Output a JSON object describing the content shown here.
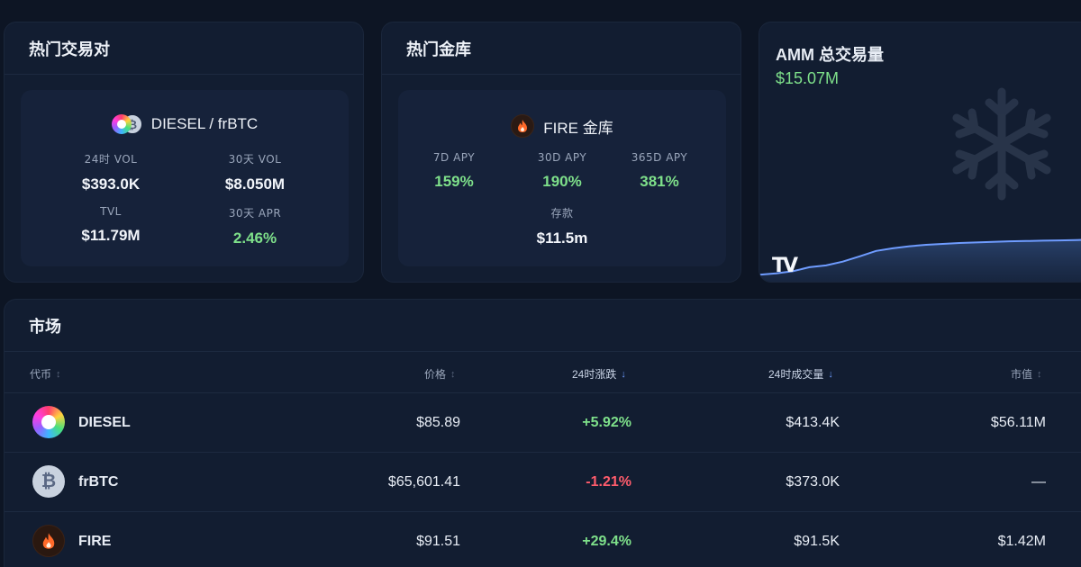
{
  "hot_pairs": {
    "title": "热门交易对",
    "pair_name": "DIESEL / frBTC",
    "stats": [
      {
        "label": "24时 VOL",
        "value": "$393.0K"
      },
      {
        "label": "30天 VOL",
        "value": "$8.050M"
      },
      {
        "label": "TVL",
        "value": "$11.79M"
      },
      {
        "label": "30天 APR",
        "value": "2.46%"
      }
    ]
  },
  "hot_vaults": {
    "title": "热门金库",
    "vault_name": "FIRE 金库",
    "stats": [
      {
        "label": "7D APY",
        "value": "159%"
      },
      {
        "label": "30D APY",
        "value": "190%"
      },
      {
        "label": "365D APY",
        "value": "381%"
      },
      {
        "label": "存款",
        "value": "$11.5m"
      }
    ]
  },
  "amm": {
    "title": "AMM 总交易量",
    "value": "$15.07M",
    "logo_text": "TV"
  },
  "chart_data": {
    "type": "area",
    "title": "AMM 总交易量",
    "x": [
      0,
      5,
      10,
      15,
      20,
      25,
      30,
      35,
      40,
      45,
      50,
      55,
      60,
      65,
      70,
      75,
      80,
      85,
      90,
      95,
      100
    ],
    "values": [
      3.0,
      3.5,
      4.2,
      5.6,
      6.2,
      7.5,
      9.3,
      11.2,
      12.1,
      12.8,
      13.3,
      13.6,
      13.9,
      14.1,
      14.3,
      14.5,
      14.6,
      14.7,
      14.8,
      14.9,
      15.07
    ],
    "ylim": [
      0,
      34
    ],
    "xlabel": "",
    "ylabel": "",
    "line_color": "#6f9cff",
    "grid": false
  },
  "market": {
    "title": "市场",
    "headers": {
      "token": "代币",
      "price": "价格",
      "change": "24时涨跌",
      "volume": "24时成交量",
      "mcap": "市值"
    },
    "rows": [
      {
        "token": "DIESEL",
        "icon": "diesel-icon",
        "price": "$85.89",
        "change": "+5.92%",
        "direction": "up",
        "volume": "$413.4K",
        "mcap": "$56.11M"
      },
      {
        "token": "frBTC",
        "icon": "bitcoin-icon",
        "price": "$65,601.41",
        "change": "-1.21%",
        "direction": "down",
        "volume": "$373.0K",
        "mcap": "—"
      },
      {
        "token": "FIRE",
        "icon": "fire-icon",
        "price": "$91.51",
        "change": "+29.4%",
        "direction": "up",
        "volume": "$91.5K",
        "mcap": "$1.42M"
      }
    ]
  },
  "colors": {
    "background": "#0d1524",
    "card": "#121d31",
    "positive": "#7ee08a",
    "negative": "#ff5c6c",
    "accent": "#6f9cff"
  }
}
